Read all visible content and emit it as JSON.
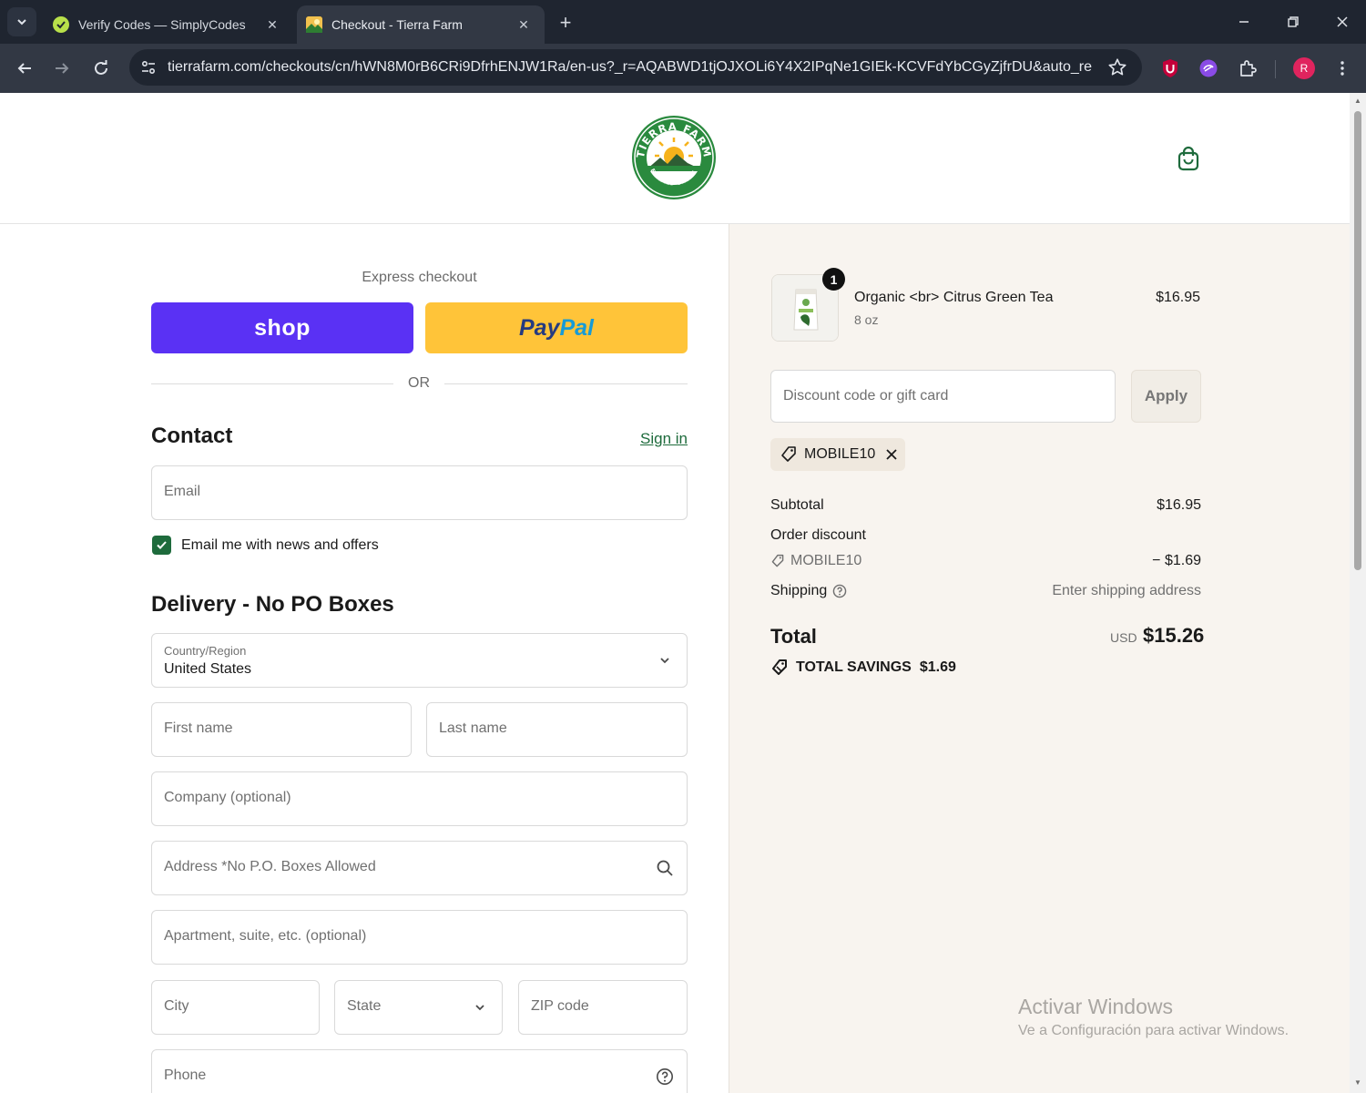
{
  "browser": {
    "tabs": [
      {
        "title": "Verify Codes — SimplyCodes",
        "active": false,
        "favicon": "simplycodes-check-icon"
      },
      {
        "title": "Checkout - Tierra Farm",
        "active": true,
        "favicon": "tierra-farm-icon"
      }
    ],
    "url": "tierrafarm.com/checkouts/cn/hWN8M0rB6CRi9DfrhENJW1Ra/en-us?_r=AQABWD1tjOJXOLi6Y4X2IPqNe1GIEk-KCVFdYbCGyZjfrDU&auto_re...",
    "profile_initial": "R",
    "colors": {
      "tabbar": "#1f2530",
      "toolbar": "#323844",
      "profile": "#e0245e"
    }
  },
  "header": {
    "logo": {
      "top_text": "TIERRA FARM",
      "est_text": "EST 1996",
      "bottom_text": "CERTIFIED ORGANIC"
    }
  },
  "express": {
    "label": "Express checkout",
    "shop_label": "shop",
    "paypal_pay": "Pay",
    "paypal_pal": "Pal",
    "or_text": "OR"
  },
  "contact": {
    "heading": "Contact",
    "sign_in": "Sign in",
    "email_placeholder": "Email",
    "news_checkbox_label": "Email me with news and offers",
    "news_checked": true
  },
  "delivery": {
    "heading": "Delivery - No PO Boxes",
    "country_label": "Country/Region",
    "country_value": "United States",
    "first_name": "First name",
    "last_name": "Last name",
    "company": "Company (optional)",
    "address": "Address *No P.O. Boxes Allowed",
    "apartment": "Apartment, suite, etc. (optional)",
    "city": "City",
    "state": "State",
    "zip": "ZIP code",
    "phone": "Phone"
  },
  "summary": {
    "product": {
      "name": "Organic <br> Citrus Green Tea",
      "variant": "8 oz",
      "price": "$16.95",
      "quantity": "1"
    },
    "discount_placeholder": "Discount code or gift card",
    "apply_label": "Apply",
    "applied_code": "MOBILE10",
    "subtotal_label": "Subtotal",
    "subtotal_value": "$16.95",
    "order_discount_label": "Order discount",
    "discount_code": "MOBILE10",
    "discount_value": "− $1.69",
    "shipping_label": "Shipping",
    "shipping_value": "Enter shipping address",
    "total_label": "Total",
    "currency": "USD",
    "total_value": "$15.26",
    "savings_label": "TOTAL SAVINGS",
    "savings_value": "$1.69"
  },
  "watermark": {
    "title": "Activar Windows",
    "subtitle": "Ve a Configuración para activar Windows."
  },
  "theme": {
    "accent": "#1e6b3c",
    "shop_purple": "#5a31f4",
    "paypal_yellow": "#ffc439",
    "summary_bg": "#f8f4ef"
  }
}
